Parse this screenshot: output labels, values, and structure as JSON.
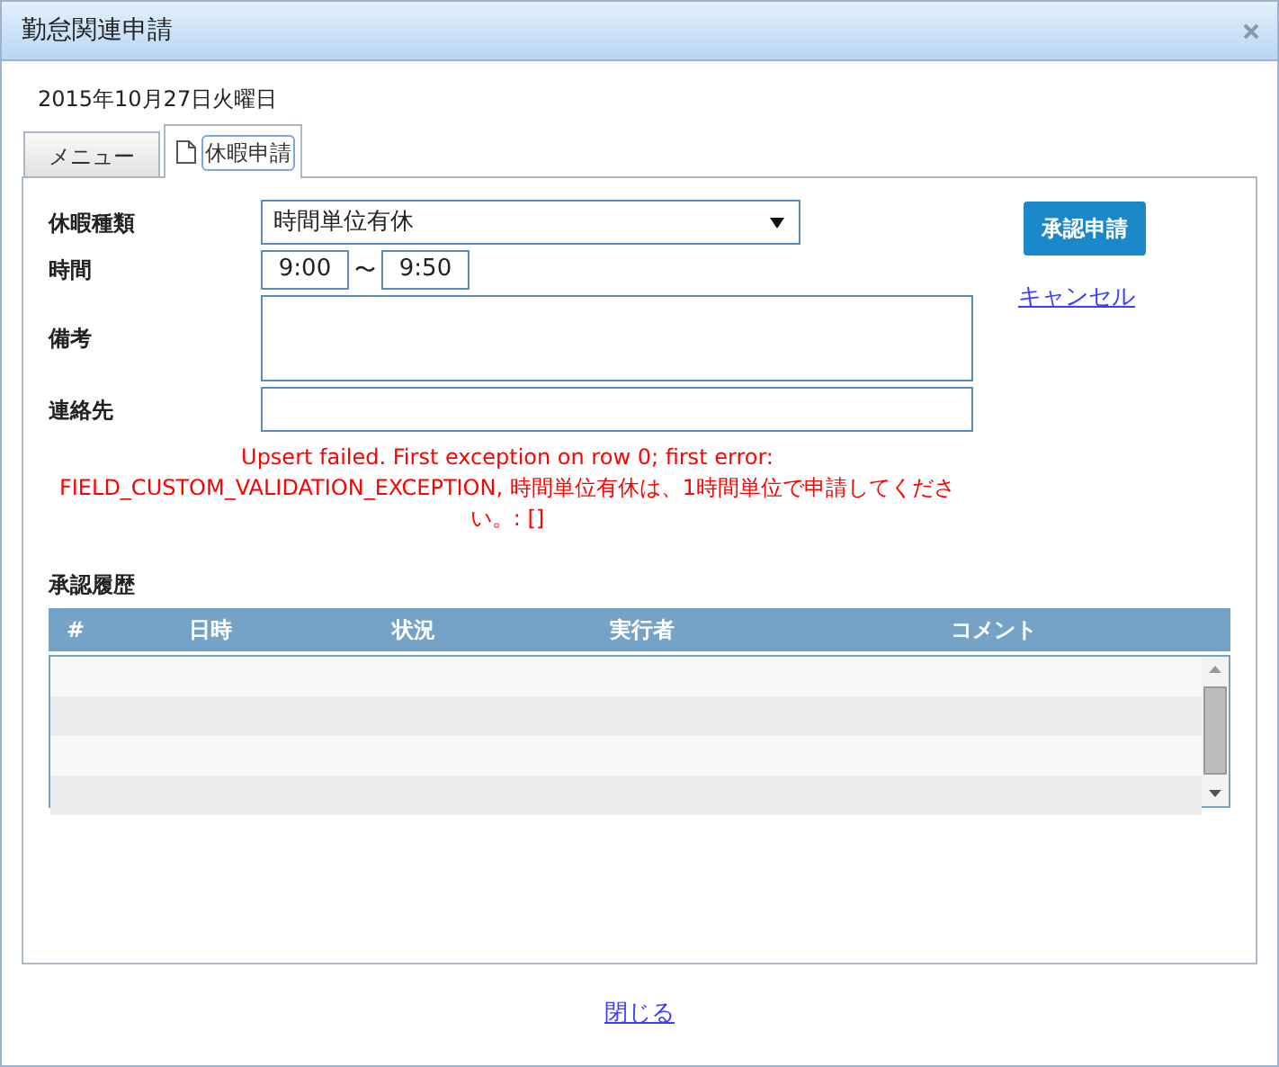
{
  "window": {
    "title": "勤怠関連申請"
  },
  "date": "2015年10月27日火曜日",
  "tabs": [
    {
      "label": "メニュー",
      "selected": false,
      "kind": "plain",
      "focused": false
    },
    {
      "label": "休暇申請",
      "selected": true,
      "kind": "document",
      "focused": true
    }
  ],
  "form": {
    "fields": [
      {
        "label": "休暇種類",
        "kind": "select",
        "value": "時間単位有休"
      },
      {
        "label": "時間",
        "kind": "time-range",
        "from": "9:00",
        "separator": "〜",
        "to": "9:50"
      },
      {
        "label": "備考",
        "kind": "textarea"
      },
      {
        "label": "連絡先",
        "kind": "input"
      }
    ],
    "error": "Upsert failed. First exception on row 0; first error: FIELD_CUSTOM_VALIDATION_EXCEPTION, 時間単位有休は、1時間単位で申請してください。: []",
    "submit_button": "承認申請",
    "cancel_link": "キャンセル"
  },
  "history": {
    "title": "承認履歴",
    "columns": [
      "#",
      "日時",
      "状況",
      "実行者",
      "コメント"
    ]
  },
  "close_link": "閉じる"
}
